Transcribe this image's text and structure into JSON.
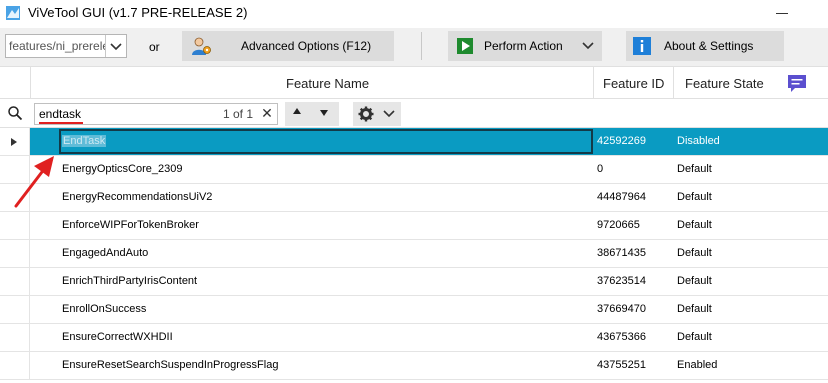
{
  "window": {
    "title": "ViVeTool GUI (v1.7 PRE-RELEASE 2)"
  },
  "toolbar": {
    "feature_combo_value": "features/ni_prerele",
    "or_label": "or",
    "advanced_options_label": "Advanced Options (F12)",
    "perform_action_label": "Perform Action",
    "about_settings_label": "About & Settings"
  },
  "grid": {
    "columns": {
      "name": "Feature Name",
      "id": "Feature ID",
      "state": "Feature State"
    },
    "search": {
      "query": "endtask",
      "count": "1 of 1",
      "clear": "✕"
    },
    "rows": [
      {
        "name": "EndTask",
        "id": "42592269",
        "state": "Disabled",
        "selected": true
      },
      {
        "name": "EnergyOpticsCore_2309",
        "id": "0",
        "state": "Default"
      },
      {
        "name": "EnergyRecommendationsUiV2",
        "id": "44487964",
        "state": "Default"
      },
      {
        "name": "EnforceWIPForTokenBroker",
        "id": "9720665",
        "state": "Default"
      },
      {
        "name": "EngagedAndAuto",
        "id": "38671435",
        "state": "Default"
      },
      {
        "name": "EnrichThirdPartyIrisContent",
        "id": "37623514",
        "state": "Default"
      },
      {
        "name": "EnrollOnSuccess",
        "id": "37669470",
        "state": "Default"
      },
      {
        "name": "EnsureCorrectWXHDII",
        "id": "43675366",
        "state": "Default"
      },
      {
        "name": "EnsureResetSearchSuspendInProgressFlag",
        "id": "43755251",
        "state": "Enabled"
      }
    ]
  },
  "colors": {
    "selection": "#0a9bc2",
    "annotation_red": "#e02020",
    "perform_green": "#1e8a2e",
    "about_blue": "#1e7fd8",
    "comment_purple": "#5b4fcf"
  },
  "icons": {
    "app": "vivetool-app-icon",
    "feature_dropdown": "chevron-down-icon",
    "advanced": "user-gear-icon",
    "perform": "play-icon",
    "perform_dropdown": "chevron-down-icon",
    "about": "info-icon",
    "comment": "comment-icon",
    "search": "search-icon",
    "settings": "gear-icon",
    "settings_dropdown": "chevron-down-icon"
  }
}
